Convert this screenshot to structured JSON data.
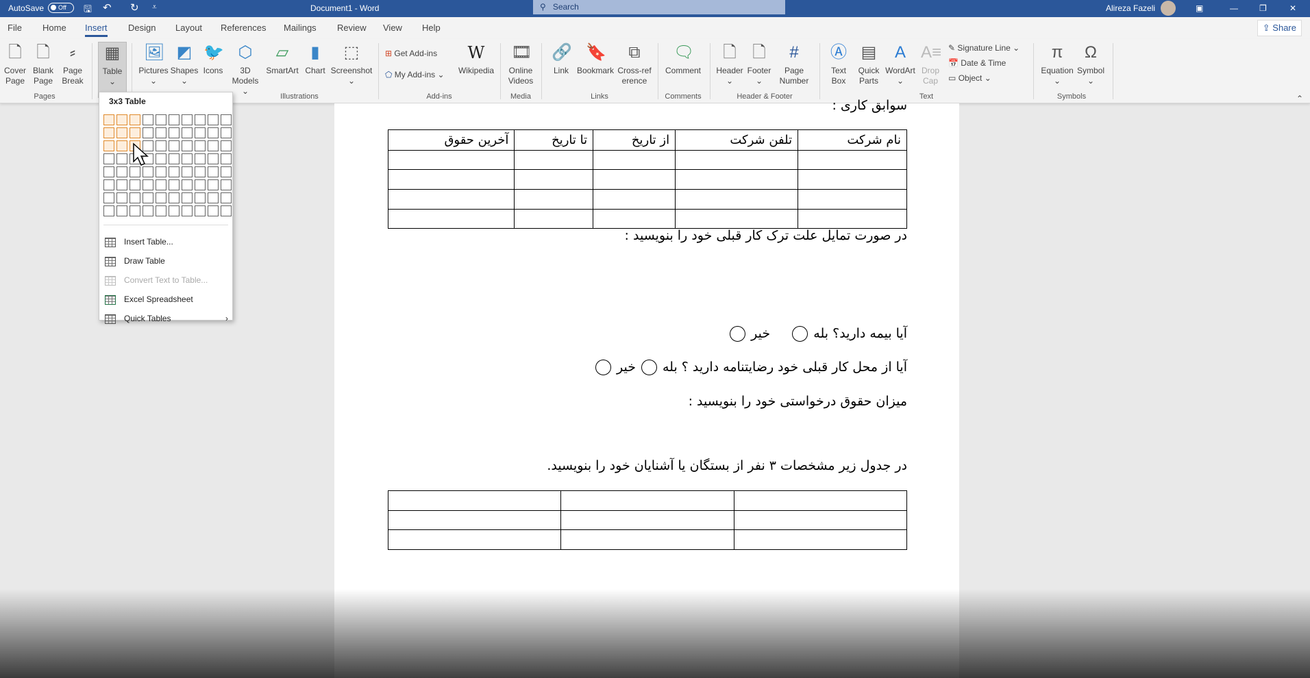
{
  "titlebar": {
    "autosave": "AutoSave",
    "autosave_state": "Off",
    "title": "Document1 - Word",
    "search": "Search",
    "user": "Alireza Fazeli"
  },
  "tabs": [
    "File",
    "Home",
    "Insert",
    "Design",
    "Layout",
    "References",
    "Mailings",
    "Review",
    "View",
    "Help"
  ],
  "active_tab": "Insert",
  "share": "Share",
  "ribbon": {
    "buttons": {
      "cover": "Cover Page",
      "blank": "Blank Page",
      "break": "Page Break",
      "table": "Table",
      "pictures": "Pictures",
      "shapes": "Shapes",
      "icons": "Icons",
      "models": "3D Models",
      "smartart": "SmartArt",
      "chart": "Chart",
      "screenshot": "Screenshot",
      "get_addins": "Get Add-ins",
      "my_addins": "My Add-ins",
      "wikipedia": "Wikipedia",
      "videos": "Online Videos",
      "link": "Link",
      "bookmark": "Bookmark",
      "crossref": "Cross-reference",
      "comment": "Comment",
      "header": "Header",
      "footer": "Footer",
      "pagenum": "Page Number",
      "textbox": "Text Box",
      "quickparts": "Quick Parts",
      "wordart": "WordArt",
      "dropcap": "Drop Cap",
      "sigline": "Signature Line",
      "datetime": "Date & Time",
      "object": "Object",
      "equation": "Equation",
      "symbol": "Symbol"
    },
    "groups": {
      "pages": "Pages",
      "illustrations": "Illustrations",
      "addins": "Add-ins",
      "media": "Media",
      "links": "Links",
      "comments": "Comments",
      "hf": "Header & Footer",
      "text": "Text",
      "symbols": "Symbols"
    }
  },
  "table_menu": {
    "title": "3x3 Table",
    "selected_rows": 3,
    "selected_cols": 3,
    "items": [
      "Insert Table...",
      "Draw Table",
      "Convert Text to Table...",
      "Excel Spreadsheet",
      "Quick Tables"
    ]
  },
  "document": {
    "heading": "سوابق کاری :",
    "work_table": {
      "headers": [
        "نام شرکت",
        "تلفن شرکت",
        "از تاریخ",
        "تا تاریخ",
        "آخرین حقوق"
      ],
      "empty_rows": 4
    },
    "line1": "در صورت تمایل علت ترک کار قبلی خود را بنویسید :",
    "q_insurance": "آیا بیمه دارید؟",
    "yes": "بله",
    "no": "خیر",
    "q_consent": "آیا از محل کار قبلی خود رضایتنامه دارید ؟",
    "line_salary": "میزان حقوق درخواستی خود را بنویسید :",
    "line_relatives": "در جدول زیر مشخصات ۳ نفر از بستگان یا آشنایان خود را بنویسید.",
    "relatives_table": {
      "rows": 3,
      "cols": 3
    }
  }
}
